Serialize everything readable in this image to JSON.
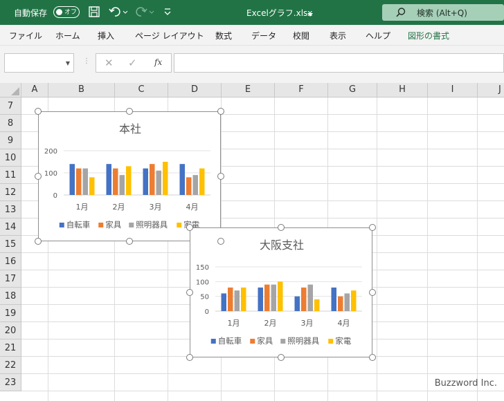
{
  "titlebar": {
    "autosave_label": "自動保存",
    "autosave_state": "オフ",
    "file_title": "Excelグラフ.xlsx",
    "search_label": "検索 (Alt+Q)"
  },
  "ribbon": {
    "tabs": [
      "ファイル",
      "ホーム",
      "挿入",
      "ページ レイアウト",
      "数式",
      "データ",
      "校閲",
      "表示",
      "ヘルプ",
      "図形の書式"
    ]
  },
  "formula_bar": {
    "fx": "fx",
    "cancel": "✕",
    "enter": "✓",
    "value": ""
  },
  "grid": {
    "columns": [
      "A",
      "B",
      "C",
      "D",
      "E",
      "F",
      "G",
      "H",
      "I",
      "J"
    ],
    "rows": [
      "7",
      "8",
      "9",
      "10",
      "11",
      "12",
      "13",
      "14",
      "15",
      "16",
      "17",
      "18",
      "19",
      "20",
      "21",
      "22",
      "23"
    ]
  },
  "colors": {
    "excel_green": "#217346",
    "series": [
      "#4472C4",
      "#ED7D31",
      "#A5A5A5",
      "#FFC000"
    ]
  },
  "charts": [
    {
      "type": "bar",
      "title": "本社",
      "categories": [
        "1月",
        "2月",
        "3月",
        "4月"
      ],
      "ylim": [
        0,
        200
      ],
      "yticks": [
        "200",
        "100",
        "0"
      ],
      "series": [
        {
          "name": "自転車",
          "values": [
            140,
            140,
            120,
            140
          ]
        },
        {
          "name": "家具",
          "values": [
            120,
            120,
            140,
            80
          ]
        },
        {
          "name": "照明器具",
          "values": [
            120,
            90,
            110,
            90
          ]
        },
        {
          "name": "家電",
          "values": [
            80,
            130,
            150,
            120
          ]
        }
      ]
    },
    {
      "type": "bar",
      "title": "大阪支社",
      "categories": [
        "1月",
        "2月",
        "3月",
        "4月"
      ],
      "ylim": [
        0,
        150
      ],
      "yticks": [
        "150",
        "100",
        "50",
        "0"
      ],
      "series": [
        {
          "name": "自転車",
          "values": [
            60,
            80,
            50,
            80
          ]
        },
        {
          "name": "家具",
          "values": [
            80,
            90,
            80,
            50
          ]
        },
        {
          "name": "照明器具",
          "values": [
            70,
            90,
            90,
            60
          ]
        },
        {
          "name": "家電",
          "values": [
            80,
            100,
            40,
            70
          ]
        }
      ]
    }
  ],
  "watermark": "Buzzword Inc."
}
